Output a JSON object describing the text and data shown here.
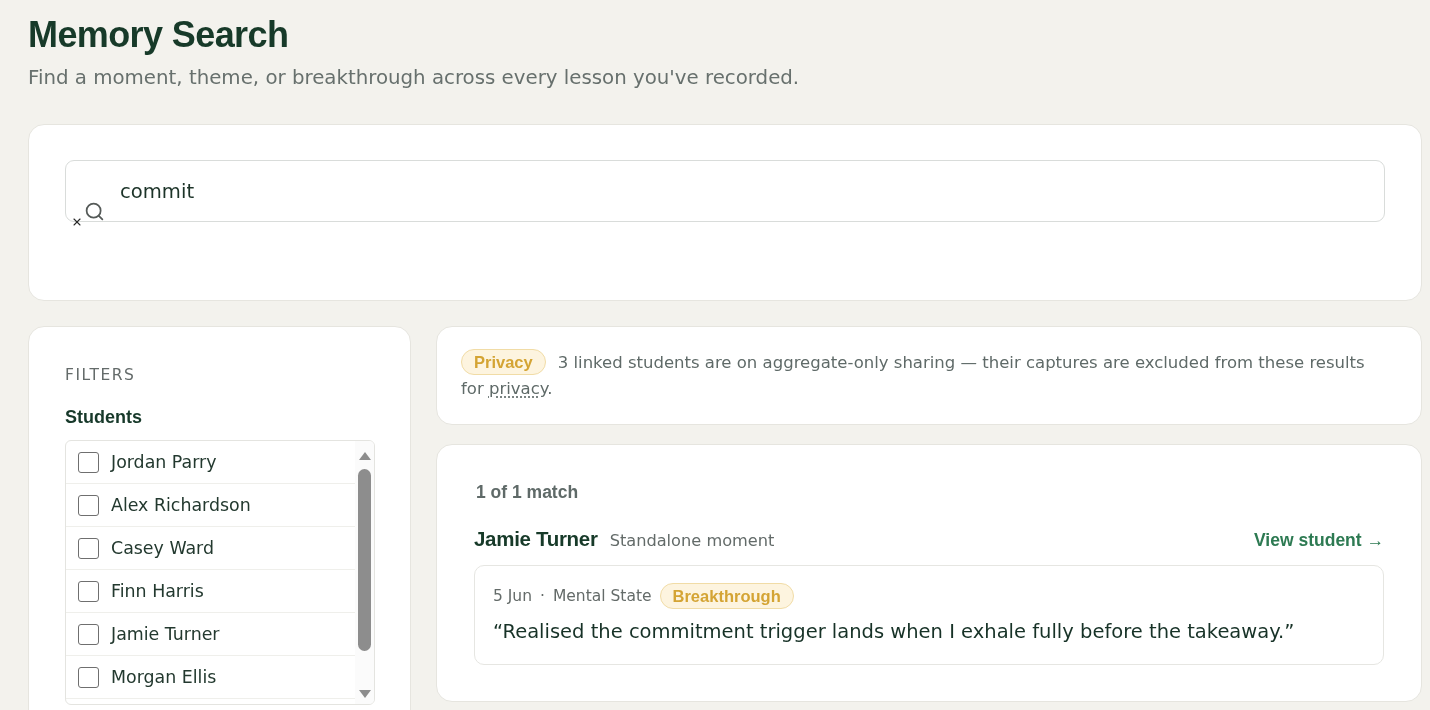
{
  "page": {
    "title": "Memory Search",
    "subtitle": "Find a moment, theme, or breakthrough across every lesson you've recorded."
  },
  "search": {
    "value": "commit"
  },
  "filters": {
    "heading": "FILTERS",
    "group_label": "Students",
    "students": [
      {
        "name": "Jordan Parry",
        "checked": false
      },
      {
        "name": "Alex Richardson",
        "checked": false
      },
      {
        "name": "Casey Ward",
        "checked": false
      },
      {
        "name": "Finn Harris",
        "checked": false
      },
      {
        "name": "Jamie Turner",
        "checked": false
      },
      {
        "name": "Morgan Ellis",
        "checked": false
      }
    ]
  },
  "privacy_notice": {
    "badge": "Privacy",
    "text": "3 linked students are on aggregate-only sharing — their captures are excluded from these results for",
    "link": "privacy",
    "text_after": "."
  },
  "results": {
    "count": "1 of 1 match",
    "groups": [
      {
        "student": "Jamie Turner",
        "context": "Standalone moment",
        "link": "View student →",
        "moments": [
          {
            "date": "5 Jun",
            "separator": "·",
            "category": "Mental State",
            "tag": "Breakthrough",
            "quote": "“Realised the commitment trigger lands when I exhale fully before the takeaway.”"
          }
        ]
      }
    ]
  }
}
